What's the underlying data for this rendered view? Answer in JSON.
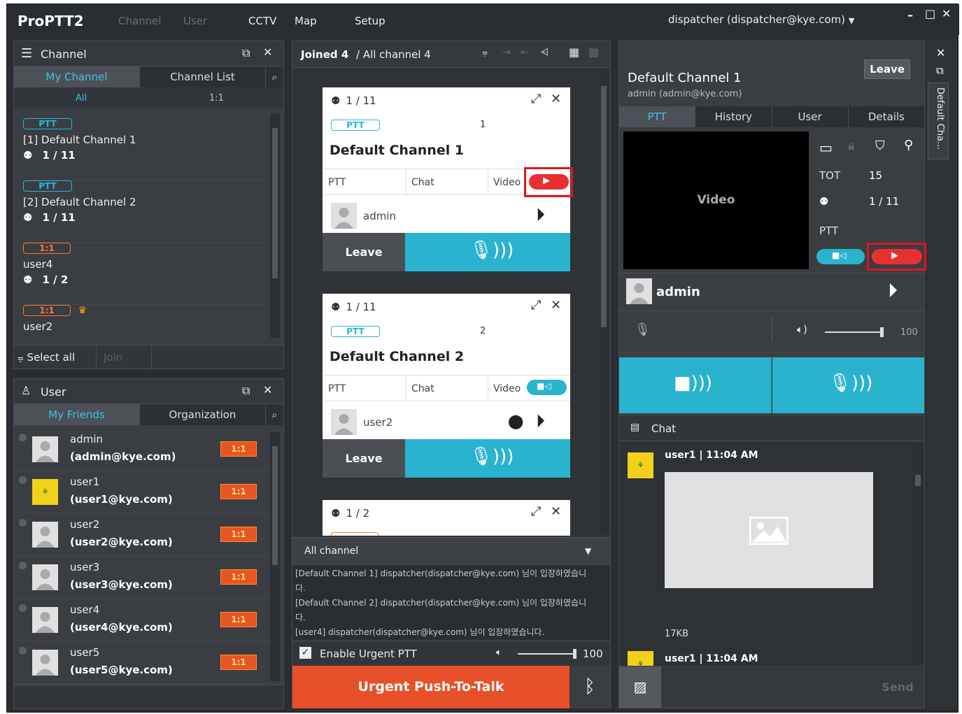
{
  "app": {
    "logo": "ProPTT2",
    "user_menu": "dispatcher (dispatcher@kye.com)"
  },
  "nav": {
    "channel": "Channel",
    "user": "User",
    "cctv": "CCTV",
    "map": "Map",
    "setup": "Setup"
  },
  "channel_panel": {
    "title": "Channel",
    "tab_my": "My Channel",
    "tab_list": "Channel List",
    "filter_all": "All",
    "filter_11": "1:1",
    "items": [
      {
        "badge": "PTT",
        "name": "[1] Default Channel 1",
        "count": "1 / 11"
      },
      {
        "badge": "PTT",
        "name": "[2] Default Channel 2",
        "count": "1 / 11"
      },
      {
        "badge": "1:1",
        "name": "user4",
        "count": "1 / 2"
      },
      {
        "badge": "1:1",
        "name": "user2",
        "count": ""
      }
    ],
    "select_all": "Select all",
    "join": "Join"
  },
  "user_panel": {
    "title": "User",
    "tab_friends": "My Friends",
    "tab_org": "Organization",
    "users": [
      {
        "name": "admin",
        "email": "(admin@kye.com)",
        "badge": "1:1"
      },
      {
        "name": "user1",
        "email": "(user1@kye.com)",
        "badge": "1:1"
      },
      {
        "name": "user2",
        "email": "(user2@kye.com)",
        "badge": "1:1"
      },
      {
        "name": "user3",
        "email": "(user3@kye.com)",
        "badge": "1:1"
      },
      {
        "name": "user4",
        "email": "(user4@kye.com)",
        "badge": "1:1"
      },
      {
        "name": "user5",
        "email": "(user5@kye.com)",
        "badge": "1:1"
      }
    ]
  },
  "center": {
    "joined": "Joined 4",
    "all": "/ All channel 4",
    "cards": [
      {
        "count": "1 / 11",
        "badge": "PTT",
        "num": "1",
        "title": "Default Channel 1",
        "ptt": "PTT",
        "chat": "Chat",
        "video": "Video",
        "speaker": "admin",
        "leave": "Leave"
      },
      {
        "count": "1 / 11",
        "badge": "PTT",
        "num": "2",
        "title": "Default Channel 2",
        "ptt": "PTT",
        "chat": "Chat",
        "video": "Video",
        "speaker": "user2",
        "leave": "Leave"
      },
      {
        "count": "1 / 2"
      }
    ],
    "log_select": "All channel",
    "log": [
      "[Default Channel 1] dispatcher(dispatcher@kye.com) 님이 입장하였습니다.",
      "[Default Channel 2] dispatcher(dispatcher@kye.com) 님이 입장하였습니다.",
      "[user4] dispatcher(dispatcher@kye.com) 님이 입장하였습니다."
    ],
    "urgent_label": "Enable Urgent PTT",
    "volume": "100",
    "urgent_btn": "Urgent Push-To-Talk"
  },
  "detail": {
    "title": "Default Channel 1",
    "owner": "admin (admin@kye.com)",
    "leave": "Leave",
    "tabs": [
      "PTT",
      "History",
      "User",
      "Details"
    ],
    "video": "Video",
    "tot_label": "TOT",
    "tot": "15",
    "count": "1 / 11",
    "ptt": "PTT",
    "speaker": "admin",
    "volume": "100",
    "chat": "Chat",
    "msgs": [
      {
        "head": "user1 | 11:04 AM",
        "size": "17KB"
      },
      {
        "head": "user1 | 11:04 AM"
      }
    ],
    "send": "Send",
    "side_tab": "Default Cha..."
  },
  "colors": {
    "accent": "#2ab3cf",
    "urgent": "#e8502a",
    "highlight": "#e0141c"
  }
}
